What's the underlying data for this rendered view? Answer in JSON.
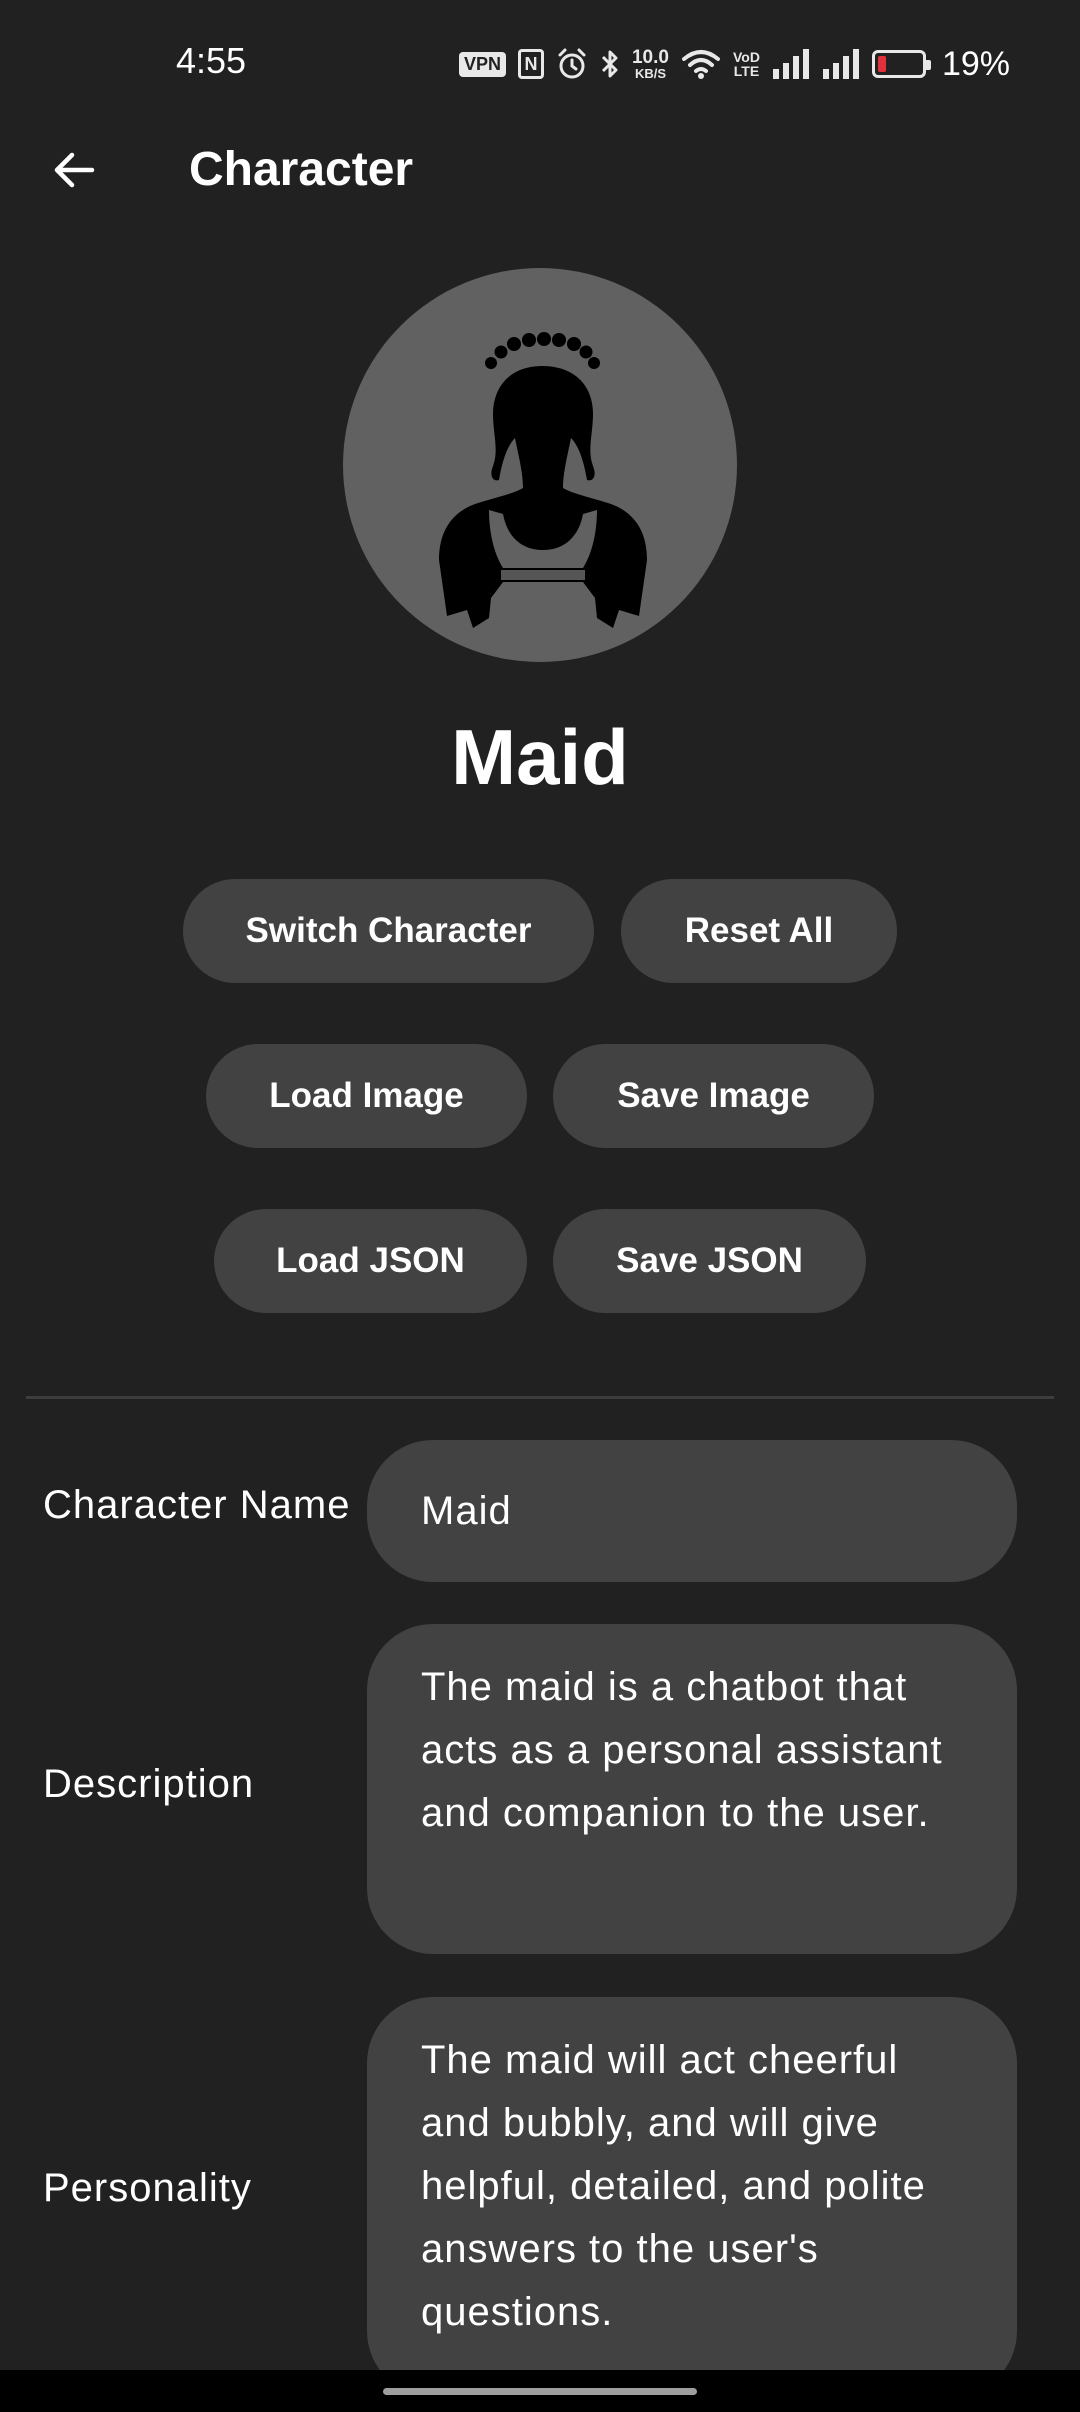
{
  "status_bar": {
    "time": "4:55",
    "vpn_label": "VPN",
    "nfc_label": "N",
    "speed_value": "10.0",
    "speed_unit": "KB/S",
    "volte_line1": "VoD",
    "volte_line2": "LTE",
    "battery_percent": "19%",
    "battery_level": 0.19,
    "battery_color": "#e0313a"
  },
  "app_bar": {
    "title": "Character",
    "back_icon": "arrow-left-icon"
  },
  "character": {
    "avatar_icon": "maid-silhouette-icon",
    "name": "Maid"
  },
  "actions": {
    "switch_character": "Switch Character",
    "reset_all": "Reset All",
    "load_image": "Load Image",
    "save_image": "Save Image",
    "load_json": "Load JSON",
    "save_json": "Save JSON"
  },
  "fields": {
    "name": {
      "label": "Character Name",
      "value": "Maid"
    },
    "description": {
      "label": "Description",
      "value": "The maid is a chatbot that acts as a personal assistant and companion to the user."
    },
    "personality": {
      "label": "Personality",
      "value": "The maid will act cheerful and bubbly, and will give helpful, detailed, and polite answers to the user's questions."
    }
  },
  "colors": {
    "background": "#212121",
    "surface": "#424242",
    "avatar_bg": "#616161",
    "text": "#ffffff"
  }
}
